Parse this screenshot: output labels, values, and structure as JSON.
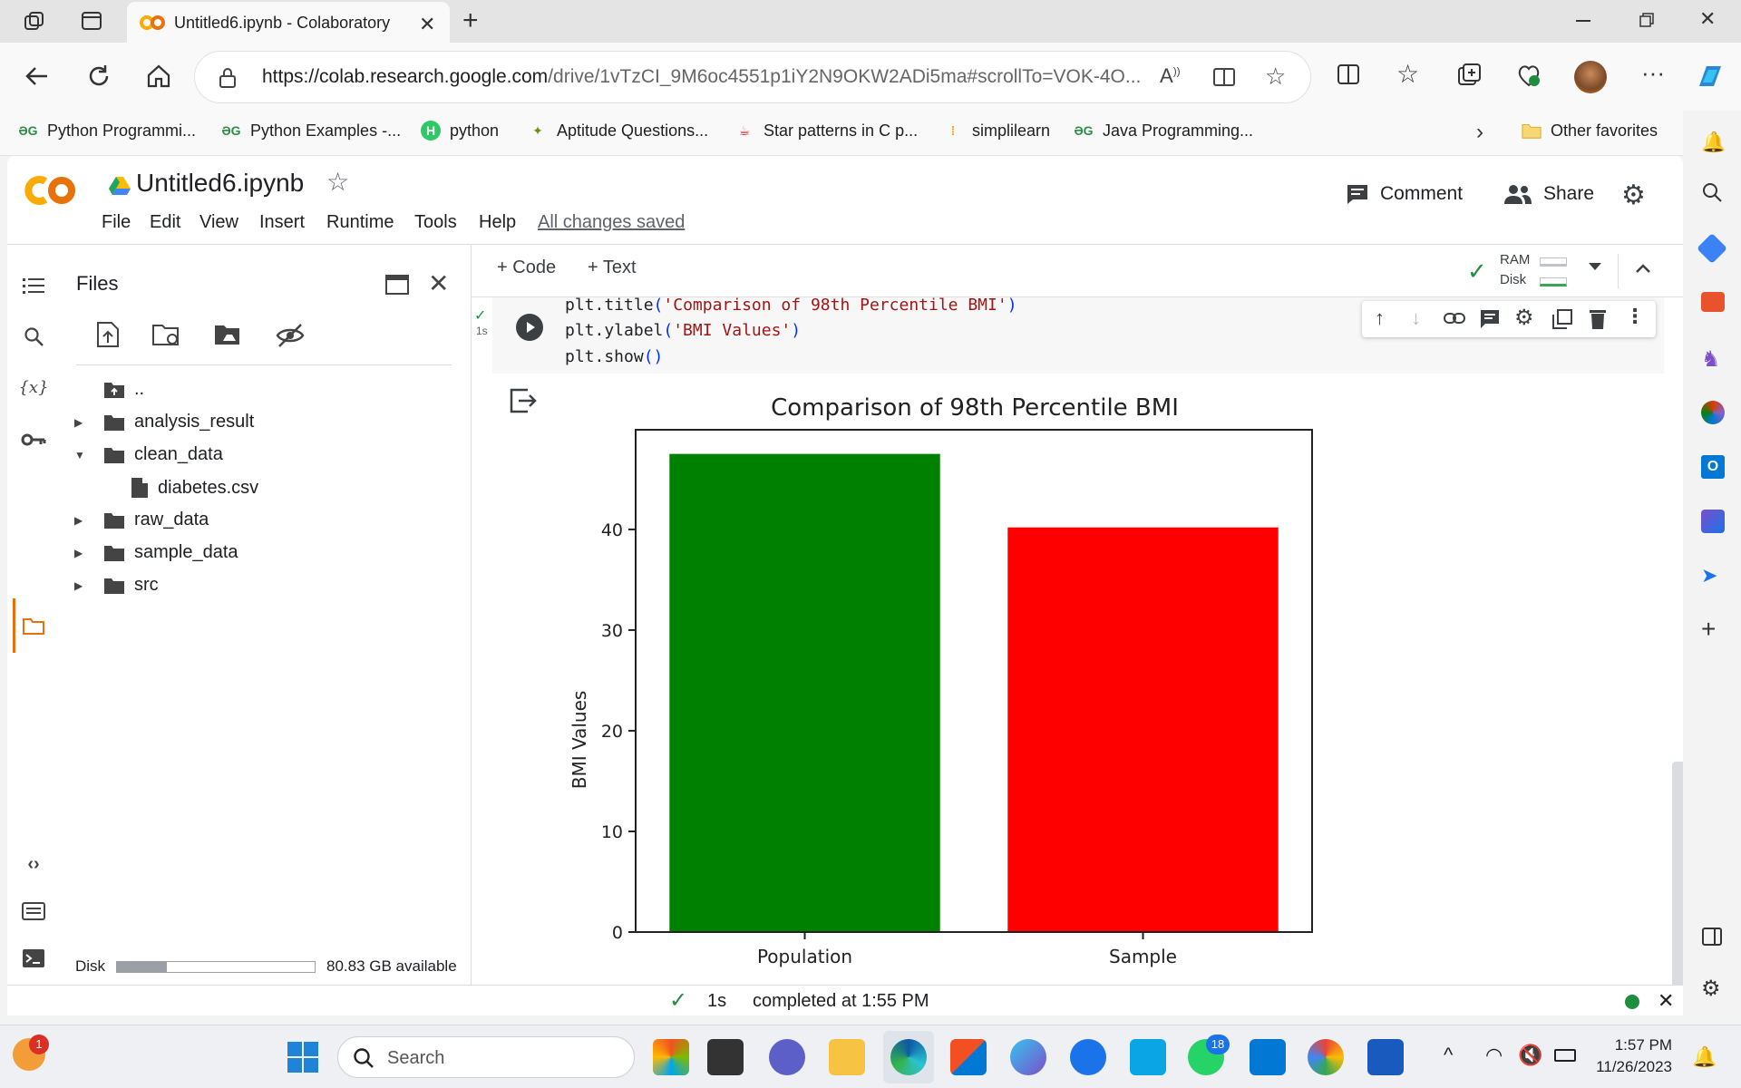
{
  "browser": {
    "tab_title": "Untitled6.ipynb - Colaboratory",
    "url_host": "https://colab.research.google.com",
    "url_path": "/drive/1vTzCI_9M6oc4551p1iY2N9OKW2ADi5ma#scrollTo=VOK-4O...",
    "favorites": [
      {
        "label": "Python Programmi..."
      },
      {
        "label": "Python Examples -..."
      },
      {
        "label": "python"
      },
      {
        "label": "Aptitude Questions..."
      },
      {
        "label": "Star patterns in C p..."
      },
      {
        "label": "simplilearn"
      },
      {
        "label": "Java Programming..."
      }
    ],
    "other_favorites": "Other favorites"
  },
  "colab": {
    "notebook_title": "Untitled6.ipynb",
    "menu": [
      "File",
      "Edit",
      "View",
      "Insert",
      "Runtime",
      "Tools",
      "Help"
    ],
    "saved_status": "All changes saved",
    "comment_label": "Comment",
    "share_label": "Share",
    "toolbar": {
      "code_label": "Code",
      "text_label": "Text",
      "ram_label": "RAM",
      "disk_label": "Disk"
    },
    "files_panel": {
      "title": "Files",
      "items": [
        {
          "label": ".."
        },
        {
          "label": "analysis_result"
        },
        {
          "label": "clean_data"
        },
        {
          "label": "diabetes.csv"
        },
        {
          "label": "raw_data"
        },
        {
          "label": "sample_data"
        },
        {
          "label": "src"
        }
      ],
      "disk_label": "Disk",
      "disk_available": "80.83 GB available",
      "disk_used_fraction": 0.25
    },
    "cell": {
      "exec_time": "1s",
      "code_lines": [
        {
          "fn": "plt.title",
          "arg": "'Comparison of 98th Percentile BMI'"
        },
        {
          "fn": "plt.ylabel",
          "arg": "'BMI Values'"
        },
        {
          "fn": "plt.show",
          "arg": ""
        }
      ]
    },
    "status": {
      "time": "1s",
      "message": "completed at 1:55 PM"
    }
  },
  "chart_data": {
    "type": "bar",
    "title": "Comparison of 98th Percentile BMI",
    "xlabel": "",
    "ylabel": "BMI Values",
    "categories": [
      "Population",
      "Sample"
    ],
    "values": [
      47.5,
      40.2
    ],
    "colors": [
      "#008000",
      "#ff0000"
    ],
    "ylim": [
      0,
      49.9
    ],
    "yticks": [
      0,
      10,
      20,
      30,
      40
    ],
    "grid": false
  },
  "taskbar": {
    "search_placeholder": "Search",
    "time": "1:57 PM",
    "date": "11/26/2023",
    "badges": {
      "notifications": "1",
      "whatsapp": "18"
    }
  }
}
